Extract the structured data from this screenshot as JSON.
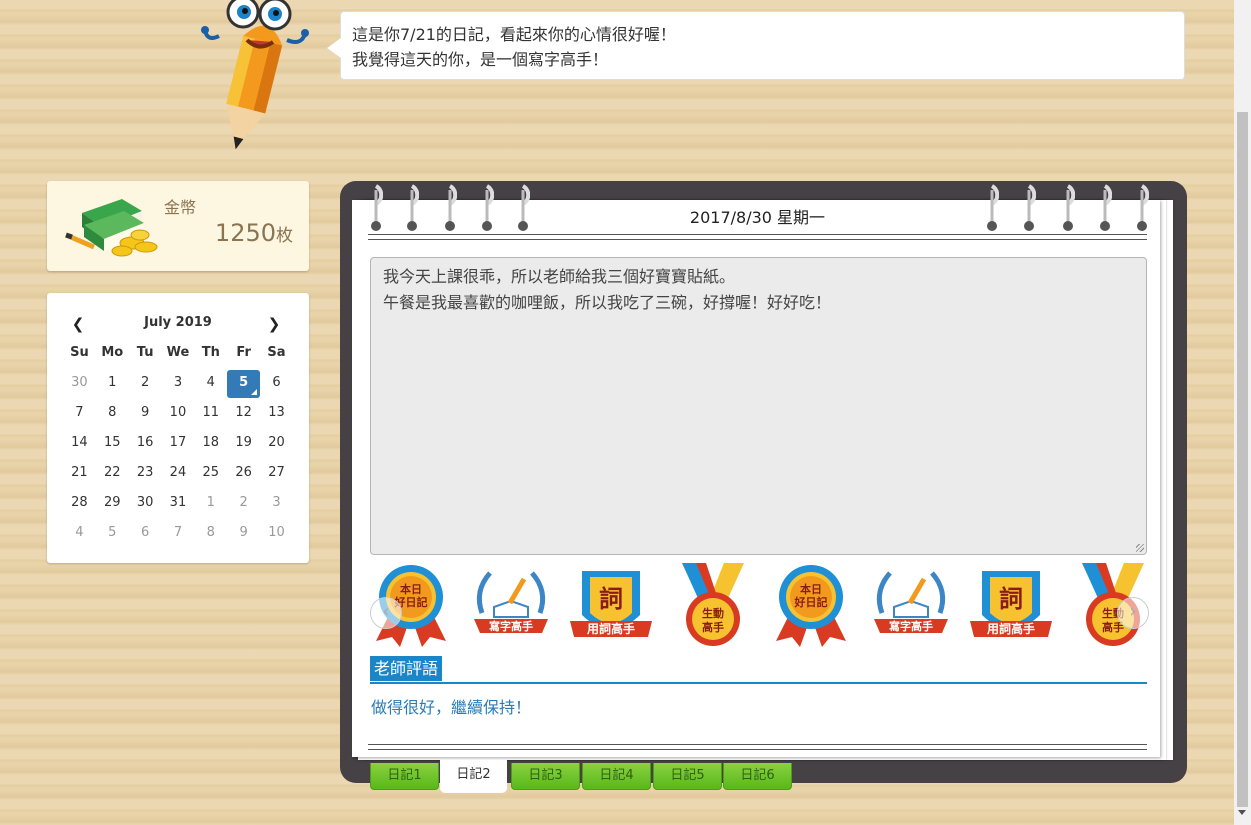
{
  "speech": {
    "line1": "這是你7/21的日記，看起來你的心情很好喔！",
    "line2": "我覺得這天的你，是一個寫字高手！"
  },
  "coins": {
    "label": "金幣",
    "amount": "1250",
    "unit": "枚"
  },
  "calendar": {
    "title": "July 2019",
    "prev_icon": "chevron-left-icon",
    "next_icon": "chevron-right-icon",
    "weekdays": [
      "Su",
      "Mo",
      "Tu",
      "We",
      "Th",
      "Fr",
      "Sa"
    ],
    "weeks": [
      [
        "30",
        "1",
        "2",
        "3",
        "4",
        "5",
        "6"
      ],
      [
        "7",
        "8",
        "9",
        "10",
        "11",
        "12",
        "13"
      ],
      [
        "14",
        "15",
        "16",
        "17",
        "18",
        "19",
        "20"
      ],
      [
        "21",
        "22",
        "23",
        "24",
        "25",
        "26",
        "27"
      ],
      [
        "28",
        "29",
        "30",
        "31",
        "1",
        "2",
        "3"
      ],
      [
        "4",
        "5",
        "6",
        "7",
        "8",
        "9",
        "10"
      ]
    ],
    "selected": "5"
  },
  "diary": {
    "date": "2017/8/30 星期一",
    "line1": "我今天上課很乖，所以老師給我三個好寶寶貼紙。",
    "line2": "午餐是我最喜歡的咖哩飯，所以我吃了三碗，好撐喔！好好吃！"
  },
  "badges": [
    {
      "name": "daily-diary-badge",
      "text1": "本日",
      "text2": "好日記"
    },
    {
      "name": "writing-master-badge",
      "text1": "寫字高手"
    },
    {
      "name": "vocabulary-master-badge",
      "text1": "詞",
      "text2": "用詞高手"
    },
    {
      "name": "vivid-master-badge",
      "text1": "生動",
      "text2": "高手"
    },
    {
      "name": "daily-diary-badge",
      "text1": "本日",
      "text2": "好日記"
    },
    {
      "name": "writing-master-badge",
      "text1": "寫字高手"
    },
    {
      "name": "vocabulary-master-badge",
      "text1": "詞",
      "text2": "用詞高手"
    },
    {
      "name": "vivid-master-badge",
      "text1": "生動",
      "text2": "高手"
    }
  ],
  "comment": {
    "title": "老師評語",
    "text": "做得很好，繼續保持！"
  },
  "tabs": [
    "日記1",
    "日記2",
    "日記3",
    "日記4",
    "日記5",
    "日記6"
  ],
  "active_tab": 1,
  "colors": {
    "accent_blue": "#1a86c8",
    "tab_green": "#6cc22a",
    "calendar_selected": "#337ab7"
  }
}
